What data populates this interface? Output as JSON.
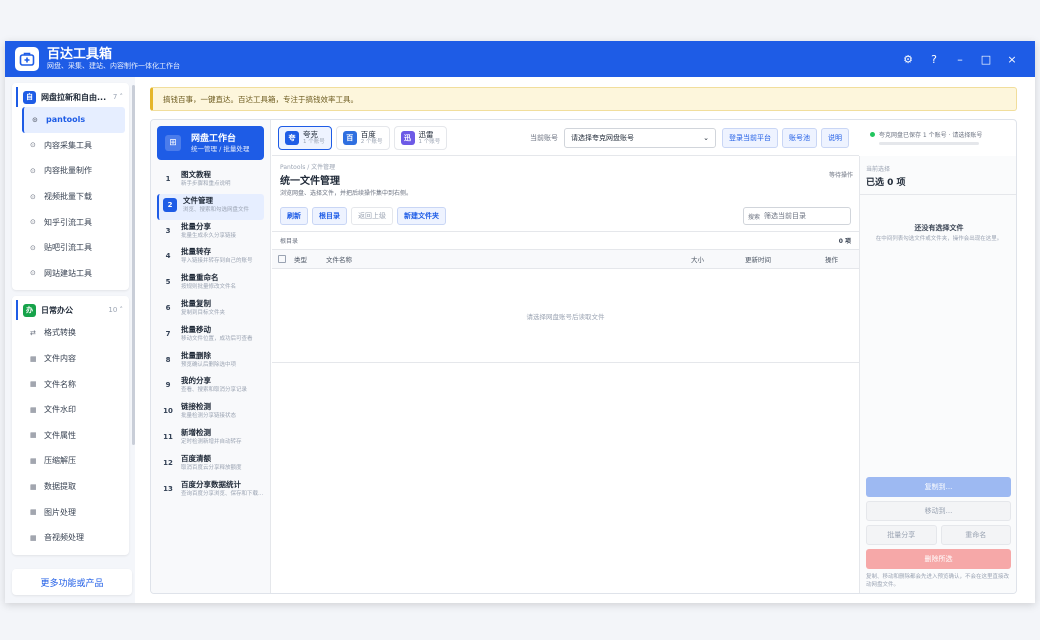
{
  "app": {
    "title": "百达工具箱",
    "subtitle": "网盘、采集、建站、内容制作一体化工作台"
  },
  "window_controls": {
    "settings": "⚙",
    "help": "?",
    "minimize": "–",
    "maximize": "□",
    "close": "×"
  },
  "sidebar": {
    "groups": [
      {
        "icon": "自",
        "icon_color": "#1e5ce6",
        "title": "网盘拉新和自由...",
        "count": "7 ˄",
        "items": [
          {
            "icon": "⊙",
            "label": "pantools",
            "active": true
          },
          {
            "icon": "⊙",
            "label": "内容采集工具"
          },
          {
            "icon": "⊙",
            "label": "内容批量制作"
          },
          {
            "icon": "⊙",
            "label": "视频批量下载"
          },
          {
            "icon": "⊙",
            "label": "知乎引流工具"
          },
          {
            "icon": "⊙",
            "label": "贴吧引流工具"
          },
          {
            "icon": "⊙",
            "label": "网站建站工具"
          }
        ]
      },
      {
        "icon": "办",
        "icon_color": "#16a34a",
        "title": "日常办公",
        "count": "10 ˄",
        "items": [
          {
            "icon": "⇄",
            "label": "格式转换"
          },
          {
            "icon": "▦",
            "label": "文件内容"
          },
          {
            "icon": "▦",
            "label": "文件名称"
          },
          {
            "icon": "▦",
            "label": "文件水印"
          },
          {
            "icon": "▦",
            "label": "文件属性"
          },
          {
            "icon": "▦",
            "label": "压缩解压"
          },
          {
            "icon": "▦",
            "label": "数据提取"
          },
          {
            "icon": "▦",
            "label": "图片处理"
          },
          {
            "icon": "▦",
            "label": "音视频处理"
          }
        ]
      }
    ],
    "more": "更多功能或产品"
  },
  "notice": "搞钱百事，一键直达。百达工具箱，专注于搞钱效率工具。",
  "workbench": {
    "icon": "⊞",
    "title": "网盘工作台",
    "subtitle": "统一管理 / 批量处理"
  },
  "steps": [
    {
      "n": "1",
      "title": "图文教程",
      "desc": "新手步骤和重点说明"
    },
    {
      "n": "2",
      "title": "文件管理",
      "desc": "浏览、搜索和勾选网盘文件",
      "active": true
    },
    {
      "n": "3",
      "title": "批量分享",
      "desc": "批量生成永久分享链接"
    },
    {
      "n": "4",
      "title": "批量转存",
      "desc": "导入链接并转存到自己的账号"
    },
    {
      "n": "5",
      "title": "批量重命名",
      "desc": "按规则批量修改文件名"
    },
    {
      "n": "6",
      "title": "批量复制",
      "desc": "复制到目标文件夹"
    },
    {
      "n": "7",
      "title": "批量移动",
      "desc": "移动文件位置，成功后可查看"
    },
    {
      "n": "8",
      "title": "批量删除",
      "desc": "预览确认后删除选中项"
    },
    {
      "n": "9",
      "title": "我的分享",
      "desc": "查看、搜索和取消分享记录"
    },
    {
      "n": "10",
      "title": "链接检测",
      "desc": "批量检测分享链接状态"
    },
    {
      "n": "11",
      "title": "新增检测",
      "desc": "定时检测新增并自动转存"
    },
    {
      "n": "12",
      "title": "百度清额",
      "desc": "取消百度云分享释放额度"
    },
    {
      "n": "13",
      "title": "百度分享数据统计",
      "desc": "查询百度分享浏览、保存和下载..."
    }
  ],
  "drives": [
    {
      "icon": "夸",
      "color": "#1e5ce6",
      "name": "夸克",
      "count": "1 个账号",
      "active": true
    },
    {
      "icon": "百",
      "color": "#2f6fe0",
      "name": "百度",
      "count": "2 个账号"
    },
    {
      "icon": "迅",
      "color": "#6d5ae6",
      "name": "迅雷",
      "count": "1 个账号"
    }
  ],
  "account": {
    "label": "当前账号",
    "selected": "请选择夸克网盘账号",
    "login_btn": "登录当前平台",
    "account_btn": "账号池",
    "help_btn": "说明"
  },
  "status": {
    "text": "夸克网盘已保存 1 个账号 · 请选择账号"
  },
  "page": {
    "breadcrumb": "Pantools / 文件管理",
    "title": "统一文件管理",
    "desc": "浏览网盘、选择文件，并把后续操作集中到右侧。",
    "action": "等待操作"
  },
  "toolbar": {
    "refresh": "刷新",
    "root": "根目录",
    "back": "返回上级",
    "new_folder": "新建文件夹",
    "filter_label": "搜索",
    "filter_placeholder": "筛选当前目录"
  },
  "path": {
    "label": "根目录",
    "count": "0 项"
  },
  "table": {
    "columns": [
      "类型",
      "文件名称",
      "大小",
      "更新时间",
      "操作"
    ],
    "empty": "请选择网盘账号后读取文件"
  },
  "right": {
    "heading": "当前选择",
    "selected": "已选 0 项",
    "empty_title": "还没有选择文件",
    "empty_desc": "在中间列表勾选文件或文件夹，操作会出现在这里。",
    "copy": "复制到...",
    "move": "移动到...",
    "share": "批量分享",
    "rename": "重命名",
    "delete": "删除所选",
    "note": "复制、移动和删除都会先进入预览确认，不会在这里直接改动网盘文件。"
  }
}
